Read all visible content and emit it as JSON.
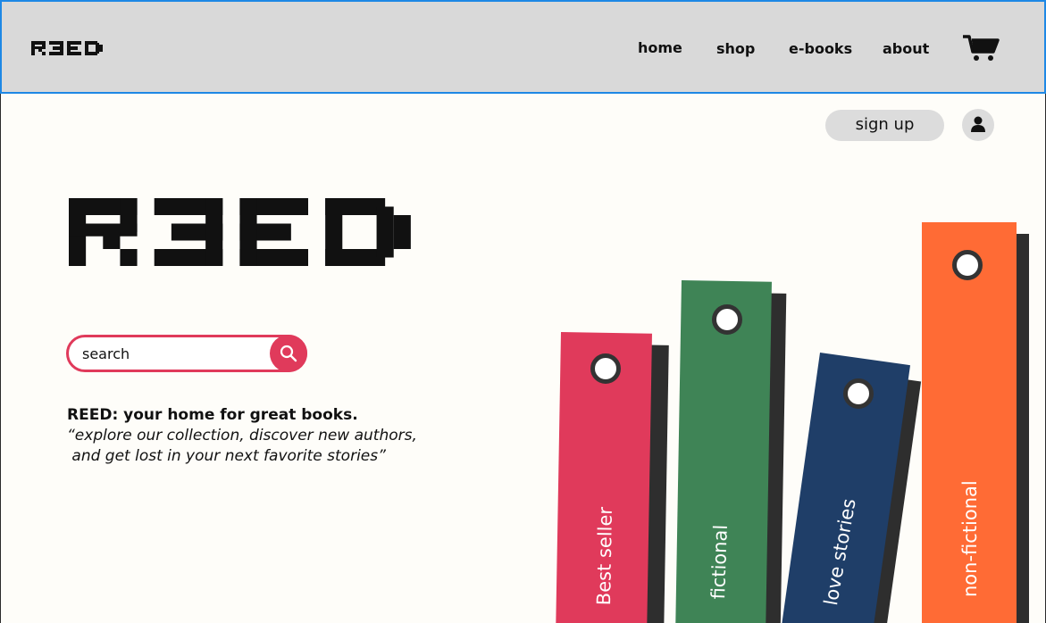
{
  "header": {
    "logo_text": "REED",
    "nav": [
      {
        "label": "home"
      },
      {
        "label": "shop"
      },
      {
        "label": "e-books"
      },
      {
        "label": "about"
      }
    ],
    "cart_icon": "cart-icon"
  },
  "account": {
    "signup_label": "sign up",
    "user_icon": "user-icon"
  },
  "hero": {
    "logo_text": "REED",
    "search": {
      "placeholder": "search",
      "value": ""
    },
    "tagline_brand": "REED",
    "tagline_rest": ": your home for great books.",
    "quote": "“explore our collection, discover new authors,\n and get lost in your next favorite stories”"
  },
  "books": [
    {
      "label": "Best seller",
      "color": "#e03a5b"
    },
    {
      "label": "fictional",
      "color": "#3f8456"
    },
    {
      "label": "love stories",
      "color": "#1f3e68"
    },
    {
      "label": "non-fictional",
      "color": "#ff6b35"
    }
  ],
  "colors": {
    "accent": "#e03a5b",
    "header_bg": "#d9d9d9",
    "header_border": "#1e88e5"
  }
}
